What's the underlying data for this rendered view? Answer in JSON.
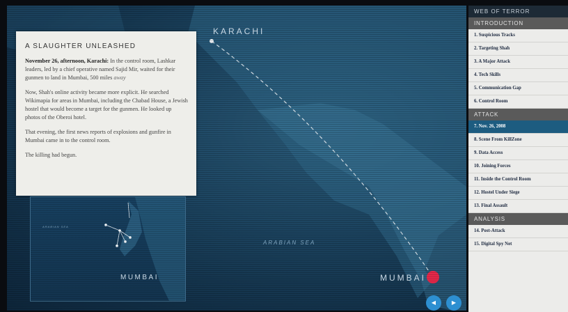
{
  "map": {
    "karachi_label": "KARACHI",
    "mumbai_label": "MUMBAI",
    "sea_label": "ARABIAN SEA"
  },
  "story": {
    "title": "A SLAUGHTER UNLEASHED",
    "p1_lead": "November 26, afternoon, Karachi:",
    "p1_body": " In the control room, Lashkar leaders, led by a chief operative named Sajid Mir, waited for their gunmen to land in Mumbai, 500 miles ",
    "p1_tail": "away",
    "p2": "Now, Shah's online activity became more explicit. He searched Wikimapia for areas in Mumbai, including the Chabad House, a Jewish hostel that would become a target for the gunmen. He looked up photos of the Oberoi hotel.",
    "p3": "That evening, the first news reports of explosions and gunfire in Mumbai came in to the control room.",
    "p4": "The killing had begun."
  },
  "inset": {
    "mumbai_label": "MUMBAI",
    "sea_label": "ARABIAN SEA"
  },
  "controls": {
    "prev_glyph": "◀",
    "next_glyph": "▶"
  },
  "sidebar": {
    "title": "WEB OF TERROR",
    "sections": [
      {
        "name": "INTRODUCTION",
        "items": [
          "1. Suspicious Tracks",
          "2. Targeting Shah",
          "3. A Major Attack",
          "4. Tech Skills",
          "5. Communication Gap",
          "6. Control Room"
        ]
      },
      {
        "name": "ATTACK",
        "items": [
          "7. Nov. 26, 2008",
          "8. Scene From KillZone",
          "9. Data Access",
          "10. Joining Forces",
          "11. Inside the Control Room",
          "12. Hostel Under Siege",
          "13. Final Assault"
        ]
      },
      {
        "name": "ANALYSIS",
        "items": [
          "14. Post-Attack",
          "15. Digital Spy Net"
        ]
      }
    ],
    "active_item": "7. Nov. 26, 2008"
  },
  "colors": {
    "active_item_bg": "#1d5c80",
    "section_header_bg": "#5a5a5a",
    "marker_red": "#e8284a",
    "nav_button_blue": "#2d8fd1"
  }
}
